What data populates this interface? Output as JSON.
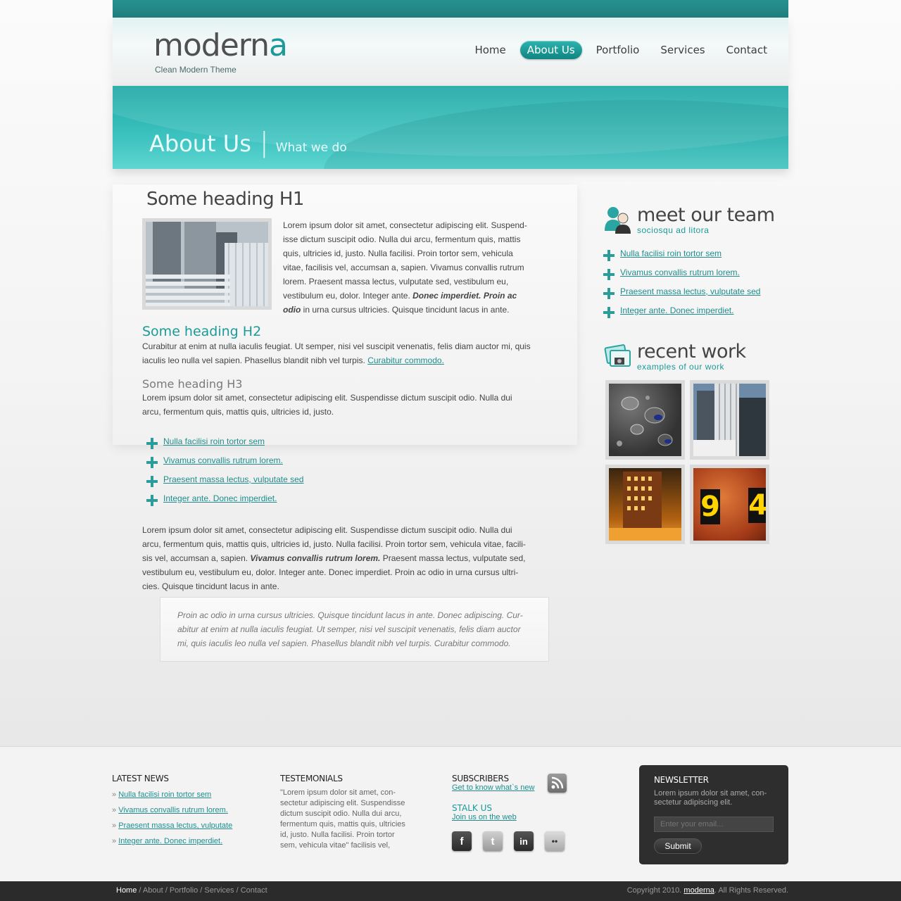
{
  "brand": {
    "logo_main": "modern",
    "logo_accent": "a",
    "tagline": "Clean Modern Theme",
    "accent_color": "#1a9b99"
  },
  "nav": {
    "items": [
      {
        "label": "Home",
        "active": false
      },
      {
        "label": "About Us",
        "active": true
      },
      {
        "label": "Portfolio",
        "active": false
      },
      {
        "label": "Services",
        "active": false
      },
      {
        "label": "Contact",
        "active": false
      }
    ]
  },
  "banner": {
    "title": "About Us",
    "separator": "|",
    "subtitle": "What we do"
  },
  "main": {
    "h1": "Some heading H1",
    "intro_text": "Lorem ipsum dolor sit amet, consectetur adipiscing elit. Suspend-isse dictum suscipit odio. Nulla dui arcu, fermentum quis, mattis quis, ultricies id, justo. Nulla facilisi. Proin tortor sem, vehicula vitae, facilisis vel, accumsan a, sapien. Vivamus convallis rutrum lorem. Praesent massa lectus, vulputate sed, vestibulum eu, vestibulum eu, dolor. Integer ante.",
    "intro_bold": "Donec imperdiet. Proin ac odio",
    "intro_tail": "in urna cursus ultricies. Quisque tincidunt lacus in ante.",
    "h2": "Some heading H2",
    "h2_text": "Curabitur at enim at nulla iaculis feugiat. Ut semper, nisi vel suscipit venenatis, felis diam auctor mi, quis iaculis leo nulla vel sapien. Phasellus blandit nibh vel turpis.",
    "h2_link": "Curabitur commodo.",
    "h3": "Some heading H3",
    "h3_text": "Lorem ipsum dolor sit amet, consectetur adipiscing elit. Suspendisse dictum suscipit odio. Nulla dui arcu, fermentum quis, mattis quis, ultricies id, justo.",
    "list": [
      "Nulla facilisi roin tortor sem",
      "Vivamus convallis rutrum lorem.",
      "Praesent massa lectus, vulputate sed",
      "Integer ante. Donec imperdiet."
    ],
    "body_text": "Lorem ipsum dolor sit amet, consectetur adipiscing elit. Suspendisse dictum suscipit odio. Nulla dui arcu, fermentum quis, mattis quis, ultricies id, justo. Nulla facilisi. Proin tortor sem, vehicula vitae, facili-sis vel, accumsan a, sapien.",
    "body_bold": "Vivamus convallis rutrum lorem.",
    "body_tail": "Praesent massa lectus, vulputate sed, vestibulum eu, vestibulum eu, dolor. Integer ante. Donec imperdiet. Proin ac odio in urna cursus ultri-cies. Quisque tincidunt lacus in ante.",
    "quote": "Proin ac odio in urna cursus ultricies. Quisque tincidunt lacus in ante. Donec adipiscing. Cur-abitur at enim at nulla iaculis feugiat. Ut semper, nisi vel suscipit venenatis, felis diam auctor mi, quis iaculis leo nulla vel sapien. Phasellus blandit nibh vel turpis. Curabitur commodo."
  },
  "sidebar": {
    "team": {
      "title": "meet our team",
      "subtitle": "sociosqu ad litora",
      "icon": "team-icon",
      "links": [
        "Nulla facilisi roin tortor sem",
        "Vivamus convallis rutrum lorem.",
        "Praesent massa lectus, vulputate sed",
        "Integer ante. Donec imperdiet."
      ]
    },
    "work": {
      "title": "recent work",
      "subtitle": "examples of our work",
      "icon": "photos-icon",
      "thumb_9": "9",
      "thumb_4": "4"
    }
  },
  "footer": {
    "news": {
      "heading": "LATEST NEWS",
      "prefix": "»",
      "items": [
        "Nulla facilisi roin tortor sem",
        "Vivamus convallis rutrum lorem.",
        "Praesent massa lectus, vulputate",
        "Integer ante. Donec imperdiet."
      ]
    },
    "testimonials": {
      "heading": "TESTEMONIALS",
      "text": "\"Lorem ipsum dolor sit amet, con-sectetur adipiscing elit. Suspendisse dictum suscipit odio. Nulla dui arcu, fermentum quis, mattis quis, ultricies id, justo. Nulla facilisi. Proin tortor sem, vehicula vitae\" facilisis vel,"
    },
    "subscribers": {
      "heading": "SUBSCRIBERS",
      "link": "Get to know what`s new",
      "stalk_heading": "STALK US",
      "stalk_link": "Join us on the web",
      "social": [
        {
          "name": "facebook-icon",
          "glyph": "f",
          "color": "#3b3b3b"
        },
        {
          "name": "twitter-icon",
          "glyph": "t",
          "color": "#a8a8a8"
        },
        {
          "name": "linkedin-icon",
          "glyph": "in",
          "color": "#3b3b3b"
        },
        {
          "name": "flickr-icon",
          "glyph": "••",
          "color": "#bdbdbd"
        }
      ]
    },
    "newsletter": {
      "heading": "NEWSLETTER",
      "text": "Lorem ipsum dolor sit amet, con-sectetur adipiscing elit.",
      "placeholder": "Enter your email...",
      "submit": "Submit"
    }
  },
  "bottombar": {
    "crumbs": [
      "Home",
      "About",
      "Portfolio",
      "Services",
      "Contact"
    ],
    "sep": " / ",
    "copyright_pre": "Copyright 2010.",
    "copyright_brand": "moderna",
    "copyright_post": ". All Rights Reserved."
  }
}
